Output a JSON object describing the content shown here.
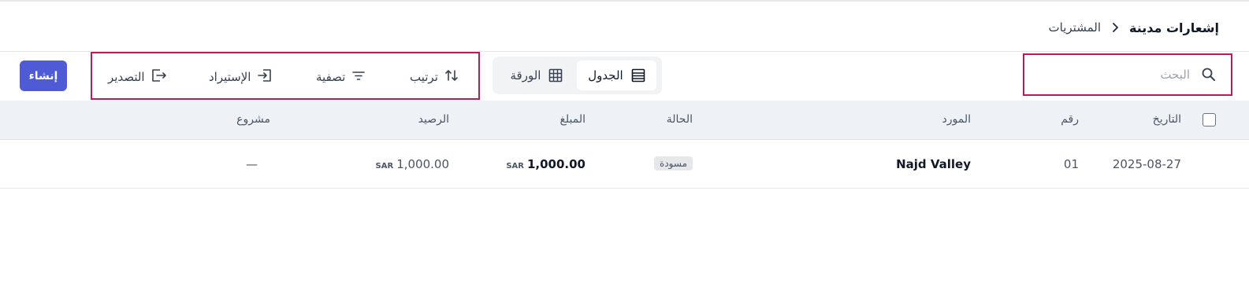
{
  "breadcrumb": {
    "parent": "المشتريات",
    "current": "إشعارات مدينة"
  },
  "search": {
    "placeholder": "البحث",
    "value": ""
  },
  "view_toggle": {
    "table_label": "الجدول",
    "sheet_label": "الورقة",
    "active": "table"
  },
  "actions": {
    "sort_label": "ترتيب",
    "filter_label": "تصفية",
    "import_label": "الإستيراد",
    "export_label": "التصدير"
  },
  "create_button": {
    "label": "إنشاء",
    "color": "#4f5bd5"
  },
  "table": {
    "columns": {
      "date": "التاريخ",
      "number": "رقم",
      "supplier": "المورد",
      "status": "الحالة",
      "amount": "المبلغ",
      "balance": "الرصيد",
      "project": "مشروع"
    },
    "rows": [
      {
        "date": "2025-08-27",
        "number": "01",
        "supplier": "Najd Valley",
        "status": "مسودة",
        "amount": "1,000.00",
        "amount_currency": "SAR",
        "balance": "1,000.00",
        "balance_currency": "SAR",
        "project": "—"
      }
    ]
  },
  "colors": {
    "highlight_border": "#c2185b",
    "header_bg": "#eef2f7"
  }
}
